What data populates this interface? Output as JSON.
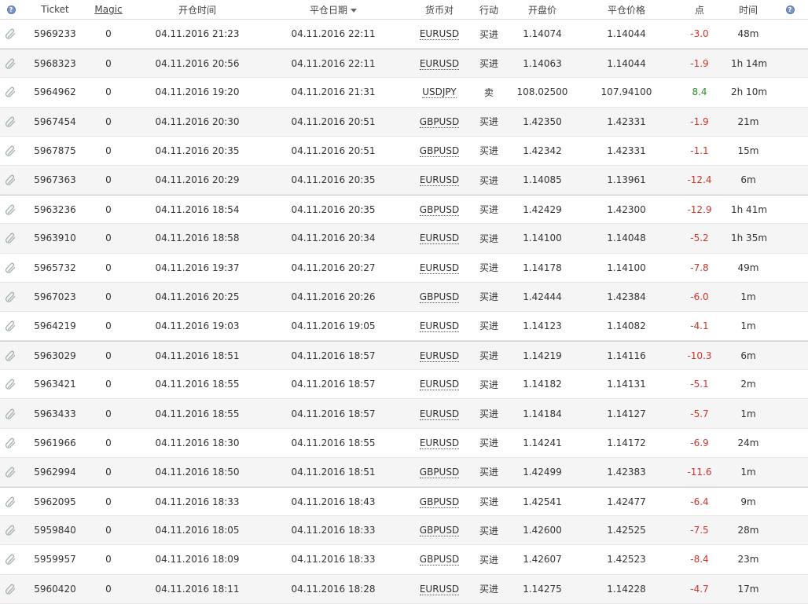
{
  "header": {
    "ticket": "Ticket",
    "magic": "Magic",
    "open_time": "开仓时间",
    "close_date": "平仓日期",
    "symbol": "货币对",
    "action": "行动",
    "open_price": "开盘价",
    "close_price": "平仓价格",
    "points": "点",
    "time": "时间",
    "help_icon": "?"
  },
  "colors": {
    "negative": "#d0342c",
    "positive": "#2e8b2e"
  },
  "icons": {
    "row": "paperclip-icon",
    "note": "speech-bubble-icon",
    "edit": "pencil-icon",
    "help": "question-icon"
  },
  "rows": [
    {
      "ticket": "5969233",
      "magic": "0",
      "open": "04.11.2016 21:23",
      "close": "04.11.2016 22:11",
      "symbol": "EURUSD",
      "action": "买进",
      "op": "1.14074",
      "cp": "1.14044",
      "pts": "-3.0",
      "time": "48m",
      "note": "speech",
      "alt": false,
      "strong": false
    },
    {
      "ticket": "5968323",
      "magic": "0",
      "open": "04.11.2016 20:56",
      "close": "04.11.2016 22:11",
      "symbol": "EURUSD",
      "action": "买进",
      "op": "1.14063",
      "cp": "1.14044",
      "pts": "-1.9",
      "time": "1h 14m",
      "note": "speech",
      "alt": true,
      "strong": true
    },
    {
      "ticket": "5964962",
      "magic": "0",
      "open": "04.11.2016 19:20",
      "close": "04.11.2016 21:31",
      "symbol": "USDJPY",
      "action": "卖",
      "op": "108.02500",
      "cp": "107.94100",
      "pts": "8.4",
      "time": "2h 10m",
      "note": "pencil",
      "alt": false,
      "strong": false
    },
    {
      "ticket": "5967454",
      "magic": "0",
      "open": "04.11.2016 20:30",
      "close": "04.11.2016 20:51",
      "symbol": "GBPUSD",
      "action": "买进",
      "op": "1.42350",
      "cp": "1.42331",
      "pts": "-1.9",
      "time": "21m",
      "note": "speech",
      "alt": true,
      "strong": false
    },
    {
      "ticket": "5967875",
      "magic": "0",
      "open": "04.11.2016 20:35",
      "close": "04.11.2016 20:51",
      "symbol": "GBPUSD",
      "action": "买进",
      "op": "1.42342",
      "cp": "1.42331",
      "pts": "-1.1",
      "time": "15m",
      "note": "speech",
      "alt": false,
      "strong": false
    },
    {
      "ticket": "5967363",
      "magic": "0",
      "open": "04.11.2016 20:29",
      "close": "04.11.2016 20:35",
      "symbol": "EURUSD",
      "action": "买进",
      "op": "1.14085",
      "cp": "1.13961",
      "pts": "-12.4",
      "time": "6m",
      "note": "speech",
      "alt": true,
      "strong": false
    },
    {
      "ticket": "5963236",
      "magic": "0",
      "open": "04.11.2016 18:54",
      "close": "04.11.2016 20:35",
      "symbol": "GBPUSD",
      "action": "买进",
      "op": "1.42429",
      "cp": "1.42300",
      "pts": "-12.9",
      "time": "1h 41m",
      "note": "speech",
      "alt": false,
      "strong": true
    },
    {
      "ticket": "5963910",
      "magic": "0",
      "open": "04.11.2016 18:58",
      "close": "04.11.2016 20:34",
      "symbol": "EURUSD",
      "action": "买进",
      "op": "1.14100",
      "cp": "1.14048",
      "pts": "-5.2",
      "time": "1h 35m",
      "note": "speech",
      "alt": true,
      "strong": false
    },
    {
      "ticket": "5965732",
      "magic": "0",
      "open": "04.11.2016 19:37",
      "close": "04.11.2016 20:27",
      "symbol": "EURUSD",
      "action": "买进",
      "op": "1.14178",
      "cp": "1.14100",
      "pts": "-7.8",
      "time": "49m",
      "note": "speech",
      "alt": false,
      "strong": false
    },
    {
      "ticket": "5967023",
      "magic": "0",
      "open": "04.11.2016 20:25",
      "close": "04.11.2016 20:26",
      "symbol": "GBPUSD",
      "action": "买进",
      "op": "1.42444",
      "cp": "1.42384",
      "pts": "-6.0",
      "time": "1m",
      "note": "speech",
      "alt": true,
      "strong": false
    },
    {
      "ticket": "5964219",
      "magic": "0",
      "open": "04.11.2016 19:03",
      "close": "04.11.2016 19:05",
      "symbol": "EURUSD",
      "action": "买进",
      "op": "1.14123",
      "cp": "1.14082",
      "pts": "-4.1",
      "time": "1m",
      "note": "speech",
      "alt": false,
      "strong": false
    },
    {
      "ticket": "5963029",
      "magic": "0",
      "open": "04.11.2016 18:51",
      "close": "04.11.2016 18:57",
      "symbol": "EURUSD",
      "action": "买进",
      "op": "1.14219",
      "cp": "1.14116",
      "pts": "-10.3",
      "time": "6m",
      "note": "speech",
      "alt": true,
      "strong": true
    },
    {
      "ticket": "5963421",
      "magic": "0",
      "open": "04.11.2016 18:55",
      "close": "04.11.2016 18:57",
      "symbol": "EURUSD",
      "action": "买进",
      "op": "1.14182",
      "cp": "1.14131",
      "pts": "-5.1",
      "time": "2m",
      "note": "speech",
      "alt": false,
      "strong": false
    },
    {
      "ticket": "5963433",
      "magic": "0",
      "open": "04.11.2016 18:55",
      "close": "04.11.2016 18:57",
      "symbol": "EURUSD",
      "action": "买进",
      "op": "1.14184",
      "cp": "1.14127",
      "pts": "-5.7",
      "time": "1m",
      "note": "speech",
      "alt": true,
      "strong": false
    },
    {
      "ticket": "5961966",
      "magic": "0",
      "open": "04.11.2016 18:30",
      "close": "04.11.2016 18:55",
      "symbol": "EURUSD",
      "action": "买进",
      "op": "1.14241",
      "cp": "1.14172",
      "pts": "-6.9",
      "time": "24m",
      "note": "speech",
      "alt": false,
      "strong": false
    },
    {
      "ticket": "5962994",
      "magic": "0",
      "open": "04.11.2016 18:50",
      "close": "04.11.2016 18:51",
      "symbol": "GBPUSD",
      "action": "买进",
      "op": "1.42499",
      "cp": "1.42383",
      "pts": "-11.6",
      "time": "1m",
      "note": "speech",
      "alt": true,
      "strong": false
    },
    {
      "ticket": "5962095",
      "magic": "0",
      "open": "04.11.2016 18:33",
      "close": "04.11.2016 18:43",
      "symbol": "GBPUSD",
      "action": "买进",
      "op": "1.42541",
      "cp": "1.42477",
      "pts": "-6.4",
      "time": "9m",
      "note": "speech",
      "alt": false,
      "strong": true
    },
    {
      "ticket": "5959840",
      "magic": "0",
      "open": "04.11.2016 18:05",
      "close": "04.11.2016 18:33",
      "symbol": "GBPUSD",
      "action": "买进",
      "op": "1.42600",
      "cp": "1.42525",
      "pts": "-7.5",
      "time": "28m",
      "note": "speech",
      "alt": true,
      "strong": false
    },
    {
      "ticket": "5959957",
      "magic": "0",
      "open": "04.11.2016 18:09",
      "close": "04.11.2016 18:33",
      "symbol": "GBPUSD",
      "action": "买进",
      "op": "1.42607",
      "cp": "1.42523",
      "pts": "-8.4",
      "time": "23m",
      "note": "speech",
      "alt": false,
      "strong": false
    },
    {
      "ticket": "5960420",
      "magic": "0",
      "open": "04.11.2016 18:11",
      "close": "04.11.2016 18:28",
      "symbol": "EURUSD",
      "action": "买进",
      "op": "1.14275",
      "cp": "1.14228",
      "pts": "-4.7",
      "time": "17m",
      "note": "speech",
      "alt": true,
      "strong": false
    }
  ]
}
